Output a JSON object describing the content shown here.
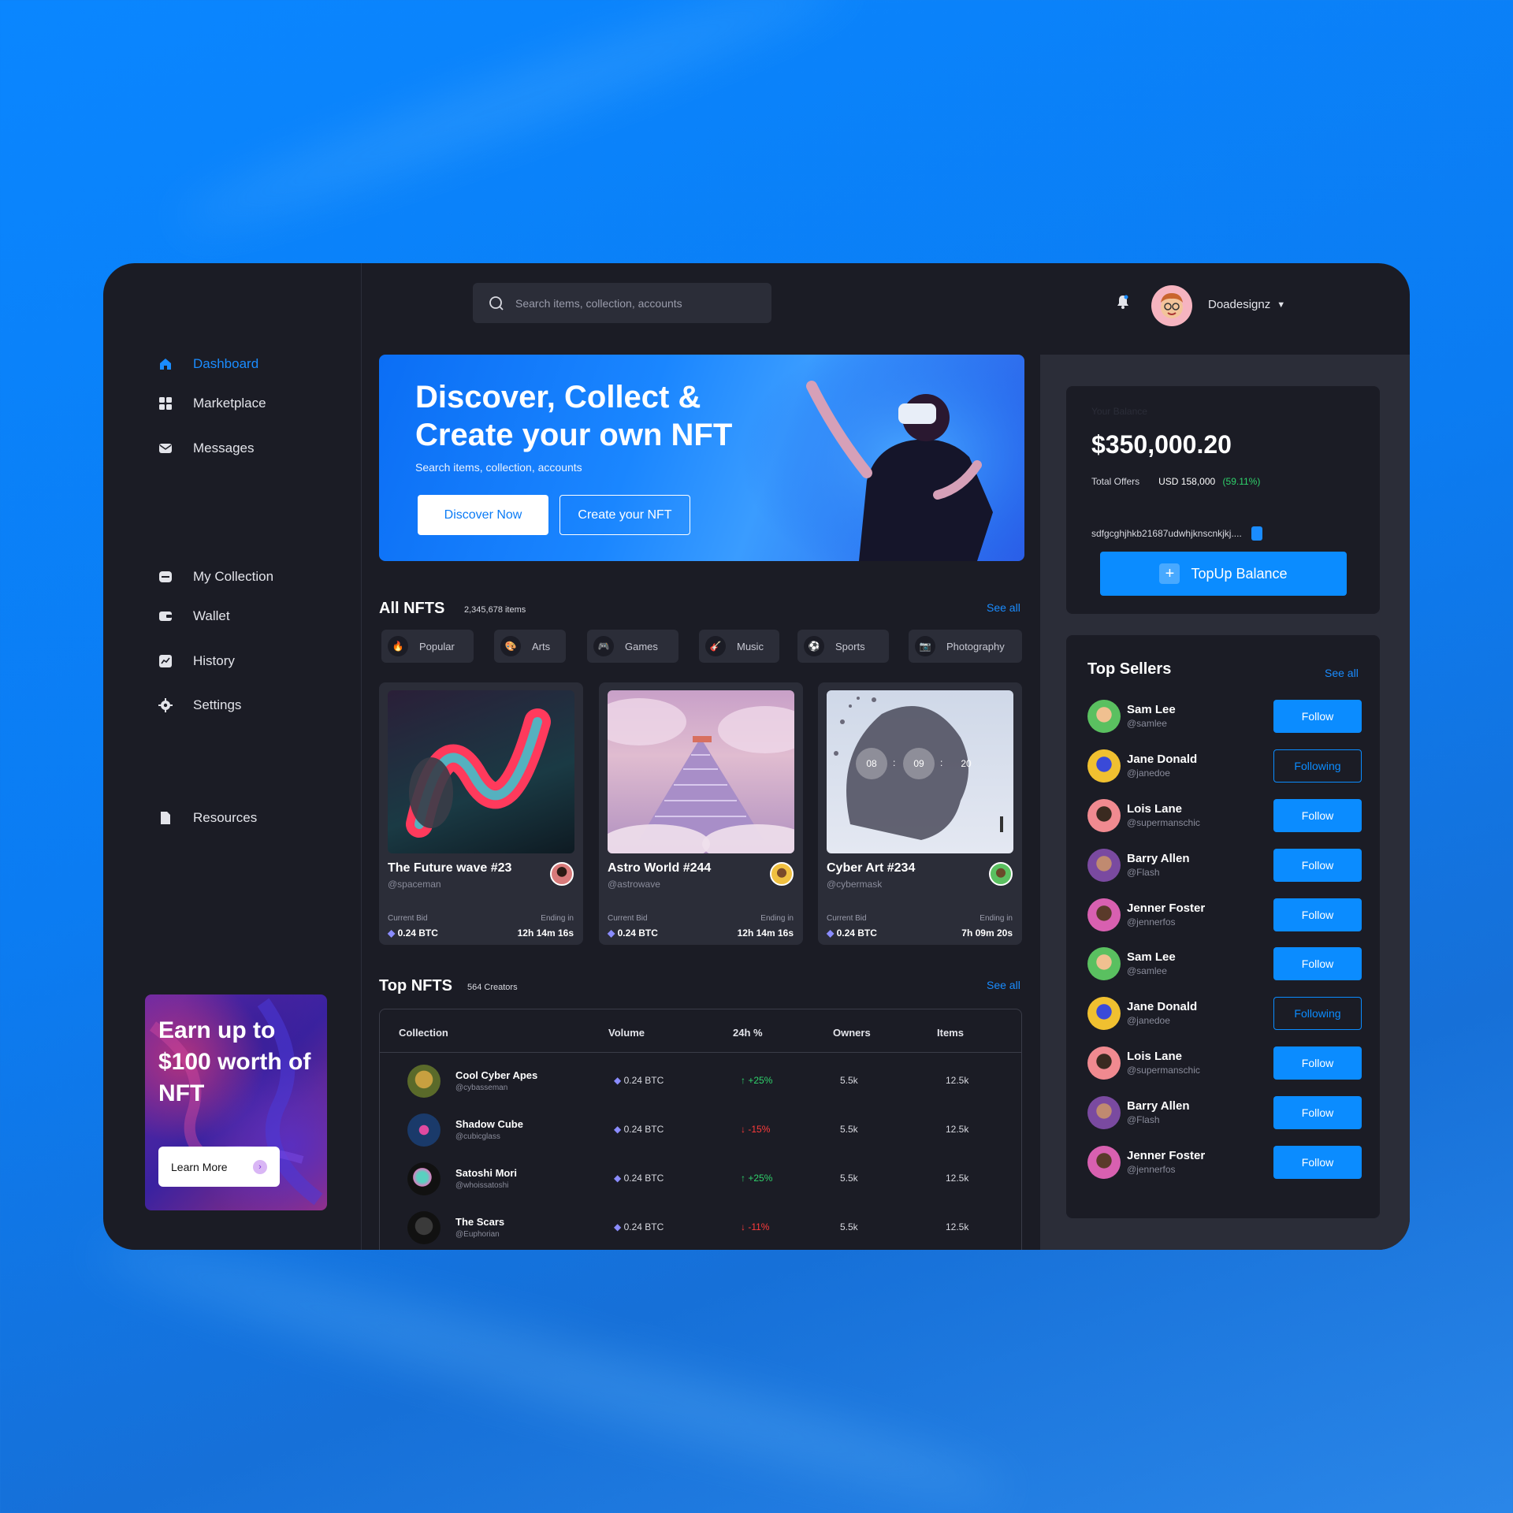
{
  "colors": {
    "accent": "#0b8cff",
    "panel": "#1b1c25",
    "panel_light": "#2b2d38",
    "up": "#2fd26b",
    "down": "#ff3b3b"
  },
  "sidebar": {
    "items": [
      {
        "label": "Dashboard",
        "icon": "home-icon",
        "active": true
      },
      {
        "label": "Marketplace",
        "icon": "grid-icon"
      },
      {
        "label": "Messages",
        "icon": "mail-icon"
      },
      {
        "label": "My Collection",
        "icon": "folder-icon"
      },
      {
        "label": "Wallet",
        "icon": "wallet-icon"
      },
      {
        "label": "History",
        "icon": "chart-icon"
      },
      {
        "label": "Settings",
        "icon": "gear-icon"
      },
      {
        "label": "Resources",
        "icon": "document-icon"
      }
    ],
    "promo": {
      "text": "Earn up to $100 worth of NFT",
      "button": "Learn More"
    }
  },
  "header": {
    "search_placeholder": "Search items, collection, accounts",
    "user_name": "Doadesignz"
  },
  "hero": {
    "title_line1": "Discover, Collect &",
    "title_line2": "Create your own NFT",
    "subtitle": "Search items, collection, accounts",
    "discover_button": "Discover Now",
    "create_button": "Create your NFT"
  },
  "all_nfts": {
    "title": "All NFTS",
    "count": "2,345,678 items",
    "see_all": "See all",
    "categories": [
      "Popular",
      "Arts",
      "Games",
      "Music",
      "Sports",
      "Photography"
    ],
    "cards": [
      {
        "title": "The Future wave #23",
        "handle": "@spaceman",
        "bid_label": "Current Bid",
        "bid": "0.24 BTC",
        "ending_label": "Ending in",
        "ending": "12h 14m 16s"
      },
      {
        "title": "Astro World #244",
        "handle": "@astrowave",
        "bid_label": "Current Bid",
        "bid": "0.24 BTC",
        "ending_label": "Ending in",
        "ending": "12h 14m 16s"
      },
      {
        "title": "Cyber Art #234",
        "handle": "@cybermask",
        "bid_label": "Current Bid",
        "bid": "0.24 BTC",
        "ending_label": "Ending in",
        "ending": "7h 09m 20s",
        "timer": [
          "08",
          "09",
          "20"
        ]
      }
    ]
  },
  "top_nfts": {
    "title": "Top NFTS",
    "count": "564 Creators",
    "see_all": "See all",
    "columns": [
      "Collection",
      "Volume",
      "24h %",
      "Owners",
      "Items"
    ],
    "rows": [
      {
        "name": "Cool Cyber Apes",
        "handle": "@cybasseman",
        "volume": "0.24 BTC",
        "change": "+25%",
        "dir": "up",
        "owners": "5.5k",
        "items": "12.5k"
      },
      {
        "name": "Shadow Cube",
        "handle": "@cubicglass",
        "volume": "0.24 BTC",
        "change": "-15%",
        "dir": "down",
        "owners": "5.5k",
        "items": "12.5k"
      },
      {
        "name": "Satoshi Mori",
        "handle": "@whoissatoshi",
        "volume": "0.24 BTC",
        "change": "+25%",
        "dir": "up",
        "owners": "5.5k",
        "items": "12.5k"
      },
      {
        "name": "The Scars",
        "handle": "@Euphorian",
        "volume": "0.24 BTC",
        "change": "-11%",
        "dir": "down",
        "owners": "5.5k",
        "items": "12.5k"
      }
    ]
  },
  "balance": {
    "label": "Your Balance",
    "amount": "$350,000.20",
    "offers_label": "Total Offers",
    "offers_value": "USD 158,000",
    "offers_pct": "(59.11%)",
    "address": "sdfgcghjhkb21687udwhjknscnkjkj....",
    "topup_button": "TopUp Balance"
  },
  "top_sellers": {
    "title": "Top Sellers",
    "see_all": "See all",
    "items": [
      {
        "name": "Sam Lee",
        "handle": "@samlee",
        "button": "Follow",
        "state": "follow"
      },
      {
        "name": "Jane Donald",
        "handle": "@janedoe",
        "button": "Following",
        "state": "following"
      },
      {
        "name": "Lois Lane",
        "handle": "@supermanschic",
        "button": "Follow",
        "state": "follow"
      },
      {
        "name": "Barry Allen",
        "handle": "@Flash",
        "button": "Follow",
        "state": "follow"
      },
      {
        "name": "Jenner Foster",
        "handle": "@jennerfos",
        "button": "Follow",
        "state": "follow"
      },
      {
        "name": "Sam Lee",
        "handle": "@samlee",
        "button": "Follow",
        "state": "follow"
      },
      {
        "name": "Jane Donald",
        "handle": "@janedoe",
        "button": "Following",
        "state": "following"
      },
      {
        "name": "Lois Lane",
        "handle": "@supermanschic",
        "button": "Follow",
        "state": "follow"
      },
      {
        "name": "Barry Allen",
        "handle": "@Flash",
        "button": "Follow",
        "state": "follow"
      },
      {
        "name": "Jenner Foster",
        "handle": "@jennerfos",
        "button": "Follow",
        "state": "follow"
      }
    ]
  }
}
